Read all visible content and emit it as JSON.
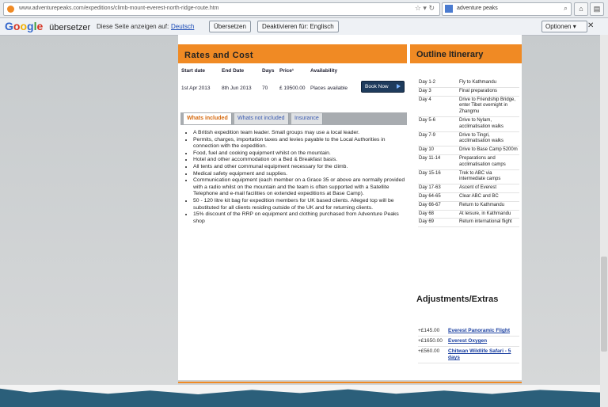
{
  "browser": {
    "url": "www.adventurepeaks.com/expeditions/climb-mount-everest-north-ridge-route.htm",
    "search_value": "adventure peaks"
  },
  "translate_bar": {
    "logo": "Google",
    "logo_sub": "übersetzer",
    "prompt": "Diese Seite anzeigen auf:",
    "language": "Deutsch",
    "translate_button": "Übersetzen",
    "disable_button": "Deaktivieren für: Englisch",
    "options_button": "Optionen"
  },
  "rates": {
    "title": "Rates and Cost",
    "headers": [
      "Start date",
      "End Date",
      "Days",
      "Price¹",
      "Availability"
    ],
    "row": {
      "start": "1st Apr 2013",
      "end": "8th Jun 2013",
      "days": "70",
      "price": "£ 19500.00",
      "availability": "Places available"
    },
    "book_button": "Book Now"
  },
  "tabs": [
    {
      "label": "Whats included",
      "active": true
    },
    {
      "label": "Whats not included",
      "active": false
    },
    {
      "label": "Insurance",
      "active": false
    }
  ],
  "included": [
    "A British expedition team leader. Small groups may use a local leader.",
    "Permits, charges, importation taxes and levies payable to the Local Authorities in connection with the expedition.",
    "Food, fuel and cooking equipment whilst on the mountain.",
    "Hotel and other accommodation on a Bed & Breakfast basis.",
    "All tents and other communal equipment necessary for the climb.",
    "Medical safety equipment and supplies.",
    "Communication equipment (each member on a Grace 35 or above are normally provided with a radio whilst on the mountain and the team is often supported with a Satellite Telephone and e-mail facilities on extended expeditions at Base Camp).",
    "50 - 120 litre kit bag for expedition members for UK based clients. Alleged top will be substituted for all clients residing outside of the UK and for returning clients.",
    "15% discount of the RRP on equipment and clothing purchased from Adventure Peaks shop"
  ],
  "itinerary": {
    "title": "Outline Itinerary",
    "rows": [
      {
        "day": "Day 1-2",
        "desc": "Fly to Kathmandu"
      },
      {
        "day": "Day 3",
        "desc": "Final preparations"
      },
      {
        "day": "Day 4",
        "desc": "Drive to Friendship Bridge, enter Tibet overnight in Zhangmu"
      },
      {
        "day": "Day 5-6",
        "desc": "Drive to Nylam, acclimatisation walks"
      },
      {
        "day": "Day 7-9",
        "desc": "Drive to Tingri, acclimatisation walks"
      },
      {
        "day": "Day 10",
        "desc": "Drive to Base Camp 5200m"
      },
      {
        "day": "Day 11-14",
        "desc": "Preparations and acclimatisation camps"
      },
      {
        "day": "Day 15-16",
        "desc": "Trek to ABC via intermediate camps"
      },
      {
        "day": "Day 17-63",
        "desc": "Ascent of Everest"
      },
      {
        "day": "Day 64-65",
        "desc": "Clear ABC and BC"
      },
      {
        "day": "Day 66-67",
        "desc": "Return to Kathmandu"
      },
      {
        "day": "Day 68",
        "desc": "At leisure, in Kathmandu"
      },
      {
        "day": "Day 69",
        "desc": "Return international flight"
      }
    ]
  },
  "extras": {
    "title": "Adjustments/Extras",
    "rows": [
      {
        "price": "+£145.00",
        "label": "Everest Panoramic Flight"
      },
      {
        "price": "+£1650.00",
        "label": "Everest Oxygen"
      },
      {
        "price": "+£560.00",
        "label": "Chitwan Wildlife Safari - 5 days"
      }
    ]
  },
  "colors": {
    "accent": "#f08a24",
    "link": "#1a3fa0",
    "book": "#1e3b5c"
  }
}
